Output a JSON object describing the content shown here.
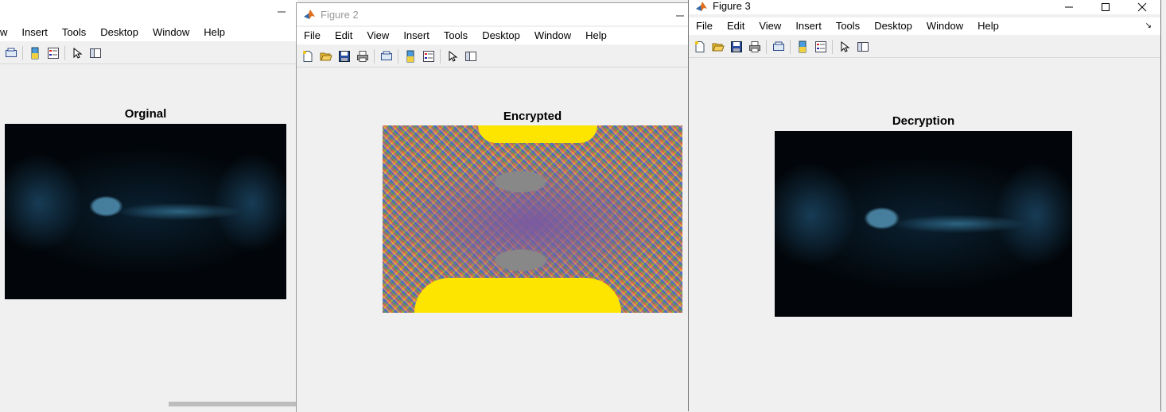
{
  "windows": {
    "fig1": {
      "menu": [
        "w",
        "Insert",
        "Tools",
        "Desktop",
        "Window",
        "Help"
      ],
      "axes_title": "Orginal",
      "min_glyph": "–"
    },
    "fig2": {
      "title": "Figure 2",
      "menu": [
        "File",
        "Edit",
        "View",
        "Insert",
        "Tools",
        "Desktop",
        "Window",
        "Help"
      ],
      "axes_title": "Encrypted",
      "min_glyph": "–"
    },
    "fig3": {
      "title": "Figure 3",
      "menu": [
        "File",
        "Edit",
        "View",
        "Insert",
        "Tools",
        "Desktop",
        "Window",
        "Help"
      ],
      "axes_title": "Decryption",
      "dock_glyph": "↘"
    }
  },
  "icons": {
    "app": "matlab-logo-icon",
    "toolbar": [
      "new-figure-icon",
      "open-file-icon",
      "save-icon",
      "print-icon",
      "link-plot-icon",
      "insert-colorbar-icon",
      "insert-legend-icon",
      "edit-plot-icon",
      "property-inspector-icon"
    ]
  }
}
